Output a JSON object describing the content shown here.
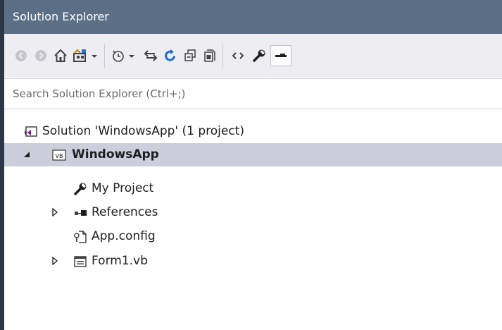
{
  "panel": {
    "title": "Solution Explorer"
  },
  "toolbar": {
    "buttons": [
      {
        "name": "back",
        "icon": "back-arrow-icon",
        "enabled": false
      },
      {
        "name": "forward",
        "icon": "forward-arrow-icon",
        "enabled": false
      },
      {
        "name": "home",
        "icon": "home-icon",
        "enabled": true
      },
      {
        "name": "switch-views",
        "icon": "switch-views-icon",
        "enabled": true,
        "dropdown": true
      },
      {
        "name": "pending-changes-filter",
        "icon": "history-clock-icon",
        "enabled": true,
        "dropdown": true
      },
      {
        "name": "sync-with-active-document",
        "icon": "sync-arrows-icon",
        "enabled": true
      },
      {
        "name": "refresh",
        "icon": "refresh-icon",
        "enabled": true
      },
      {
        "name": "collapse-all",
        "icon": "collapse-all-icon",
        "enabled": true
      },
      {
        "name": "show-all-files",
        "icon": "show-all-files-icon",
        "enabled": true
      },
      {
        "name": "view-code",
        "icon": "view-code-icon",
        "enabled": true
      },
      {
        "name": "properties",
        "icon": "wrench-icon",
        "enabled": true
      },
      {
        "name": "preview-selected-items",
        "icon": "preview-icon",
        "enabled": true,
        "active": true
      }
    ]
  },
  "search": {
    "placeholder": "Search Solution Explorer (Ctrl+;)"
  },
  "tree": {
    "solution": {
      "label": "Solution 'WindowsApp' (1 project)",
      "icon": "solution-icon"
    },
    "project": {
      "label": "WindowsApp",
      "icon": "vb-project-icon",
      "expanded": true,
      "selected": true
    },
    "items": [
      {
        "label": "My Project",
        "icon": "wrench-icon",
        "expandable": false
      },
      {
        "label": "References",
        "icon": "references-icon",
        "expandable": true
      },
      {
        "label": "App.config",
        "icon": "config-file-icon",
        "expandable": false
      },
      {
        "label": "Form1.vb",
        "icon": "form-icon",
        "expandable": true
      }
    ]
  },
  "colors": {
    "title_bar": "#5b6f87",
    "toolbar": "#eeeef2",
    "selected_row": "#cccedb",
    "accent_blue": "#1f6fcf",
    "accent_purple": "#68217a"
  }
}
